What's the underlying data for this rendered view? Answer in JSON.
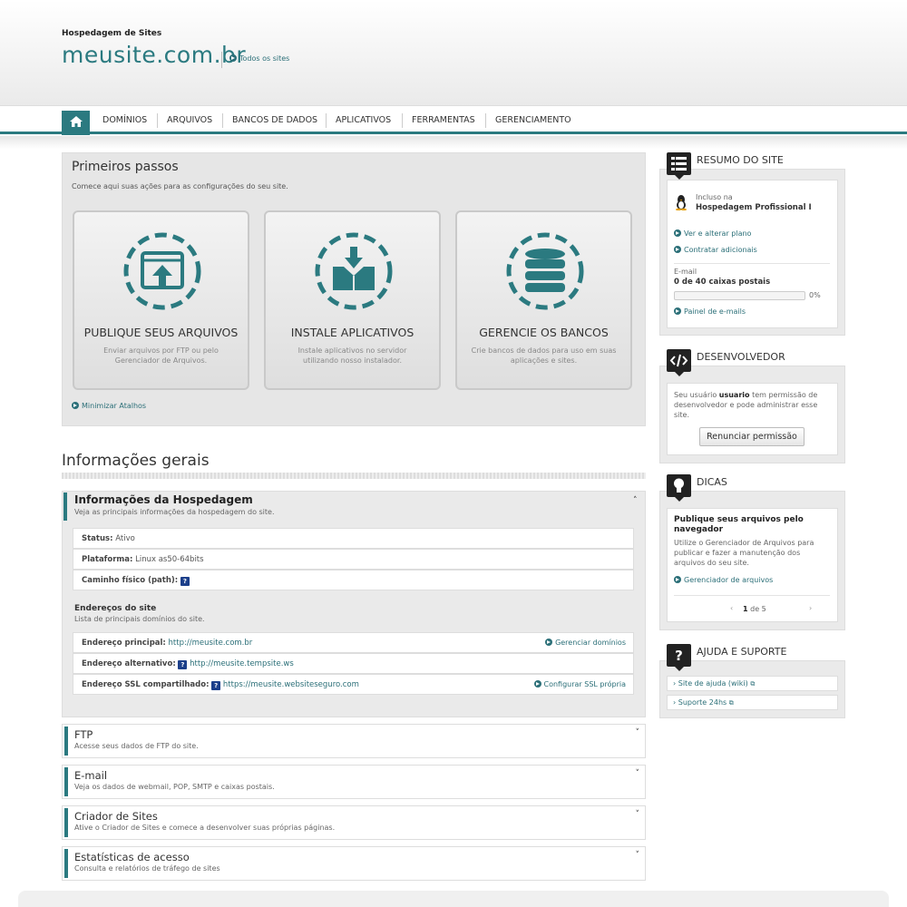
{
  "header": {
    "label": "Hospedagem de Sites",
    "site_name": "meusite.com.br",
    "all_sites": "Todos os sites"
  },
  "nav": {
    "items": [
      "DOMÍNIOS",
      "ARQUIVOS",
      "BANCOS DE DADOS",
      "APLICATIVOS",
      "FERRAMENTAS",
      "GERENCIAMENTO"
    ]
  },
  "first_steps": {
    "title": "Primeiros passos",
    "subtitle": "Comece aqui suas ações para as configurações do seu site.",
    "cards": [
      {
        "title": "PUBLIQUE SEUS ARQUIVOS",
        "desc": "Enviar arquivos por FTP ou pelo Gerenciador de Arquivos."
      },
      {
        "title": "INSTALE APLICATIVOS",
        "desc": "Instale aplicativos no servidor utilizando nosso instalador."
      },
      {
        "title": "GERENCIE OS BANCOS",
        "desc": "Crie bancos de dados para uso em suas aplicações e sites."
      }
    ],
    "minimize": "Minimizar Atalhos"
  },
  "general_info": {
    "title": "Informações gerais",
    "hosting": {
      "title": "Informações da Hospedagem",
      "subtitle": "Veja as principais informações da hospedagem do site.",
      "status_label": "Status:",
      "status_value": "Ativo",
      "platform_label": "Plataforma:",
      "platform_value": "Linux as50-64bits",
      "path_label": "Caminho físico (path):",
      "addresses_title": "Endereços do site",
      "addresses_subtitle": "Lista de principais domínios do site.",
      "main_label": "Endereço principal:",
      "main_value": "http://meusite.com.br",
      "manage_domains": "Gerenciar domínios",
      "alt_label": "Endereço alternativo:",
      "alt_value": "http://meusite.tempsite.ws",
      "ssl_label": "Endereço SSL compartilhado:",
      "ssl_value": "https://meusite.websiteseguro.com",
      "ssl_config": "Configurar SSL própria"
    },
    "accordions": [
      {
        "title": "FTP",
        "subtitle": "Acesse seus dados de FTP do site."
      },
      {
        "title": "E-mail",
        "subtitle": "Veja os dados de webmail, POP, SMTP e caixas postais."
      },
      {
        "title": "Criador de Sites",
        "subtitle": "Ative o Criador de Sites e comece a desenvolver suas próprias páginas."
      },
      {
        "title": "Estatísticas de acesso",
        "subtitle": "Consulta e relatórios de tráfego de sites"
      }
    ]
  },
  "sidebar": {
    "summary": {
      "heading": "RESUMO DO SITE",
      "included_in": "Incluso na",
      "plan": "Hospedagem Profissional I",
      "see_plan": "Ver e alterar plano",
      "hire_more": "Contratar adicionais",
      "email_label": "E-mail",
      "mailboxes": "0 de 40 caixas postais",
      "progress_pct": 0,
      "progress_label": "0%",
      "email_panel": "Painel de e-mails"
    },
    "developer": {
      "heading": "DESENVOLVEDOR",
      "text_before": "Seu usuário",
      "user": "usuario",
      "text_after": "tem permissão de desenvolvedor e pode administrar esse site.",
      "button": "Renunciar permissão"
    },
    "tips": {
      "heading": "DICAS",
      "title": "Publique seus arquivos pelo navegador",
      "text": "Utilize o Gerenciador de Arquivos para publicar e fazer a manutenção dos arquivos do seu site.",
      "link": "Gerenciador de arquivos",
      "page_current": "1",
      "page_of": "de 5"
    },
    "help": {
      "heading": "AJUDA E SUPORTE",
      "items": [
        "Site de ajuda (wiki)",
        "Suporte 24hs"
      ]
    }
  },
  "colors": {
    "accent": "#2b7a80",
    "dark": "#222222"
  }
}
